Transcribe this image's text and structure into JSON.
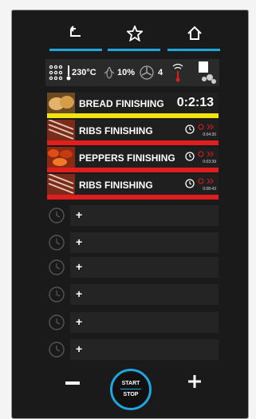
{
  "nav": {
    "back_icon": "back-arrow-icon",
    "favorite_icon": "star-icon",
    "home_icon": "home-icon",
    "accent": "#1fa6de"
  },
  "status": {
    "temperature": "230°C",
    "humidity": "10%",
    "fan_speed": "4"
  },
  "programs": [
    {
      "label": "BREAD FINISHING",
      "time": "0:2:13",
      "bar_color": "#f2e312",
      "time_small": ""
    },
    {
      "label": "RIBS FINISHING",
      "time": "",
      "bar_color": "#e11d1d",
      "time_small": "0:04:30"
    },
    {
      "label": "PEPPERS FINISHING",
      "time": "",
      "bar_color": "#e11d1d",
      "time_small": "0:03:39"
    },
    {
      "label": "RIBS FINISHING",
      "time": "",
      "bar_color": "#e11d1d",
      "time_small": "0:08:43"
    }
  ],
  "empty_slots": [
    "+",
    "+",
    "+",
    "+",
    "+",
    "+"
  ],
  "controls": {
    "start_label": "START",
    "stop_label": "STOP"
  }
}
